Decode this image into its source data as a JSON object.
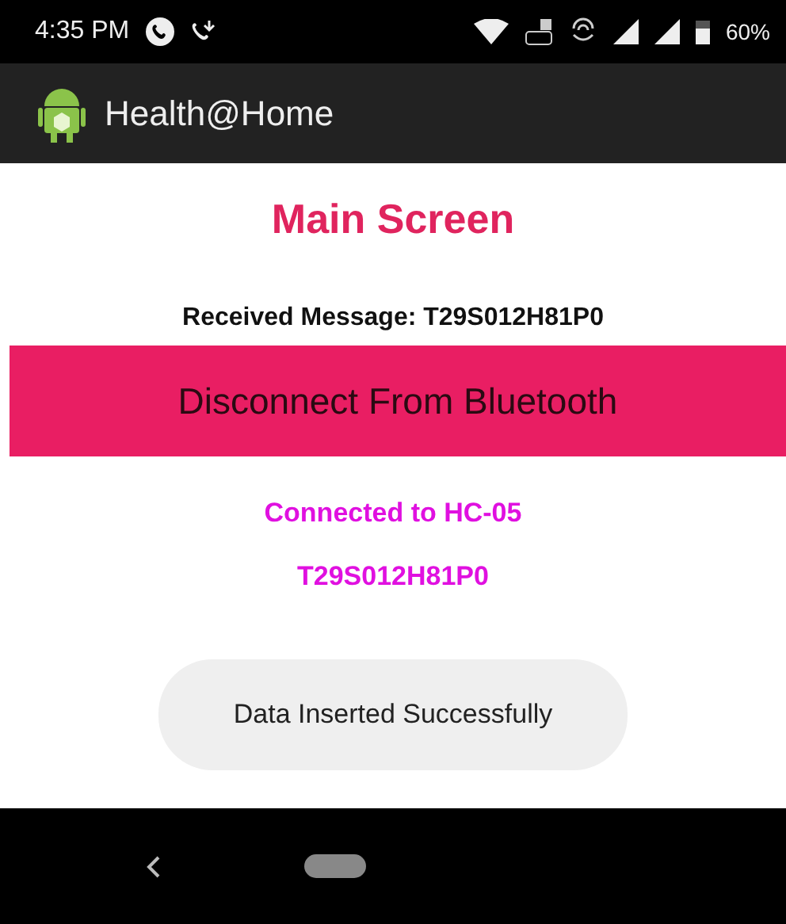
{
  "status_bar": {
    "time": "4:35 PM",
    "battery": "60%"
  },
  "app_bar": {
    "title": "Health@Home"
  },
  "screen_title": "Main Screen",
  "received_message": "Received Message: T29S012H81P0",
  "disconnect_button": "Disconnect From Bluetooth",
  "connection_status": "Connected to HC-05",
  "latest_reading": "T29S012H81P0",
  "toast": "Data Inserted Successfully"
}
